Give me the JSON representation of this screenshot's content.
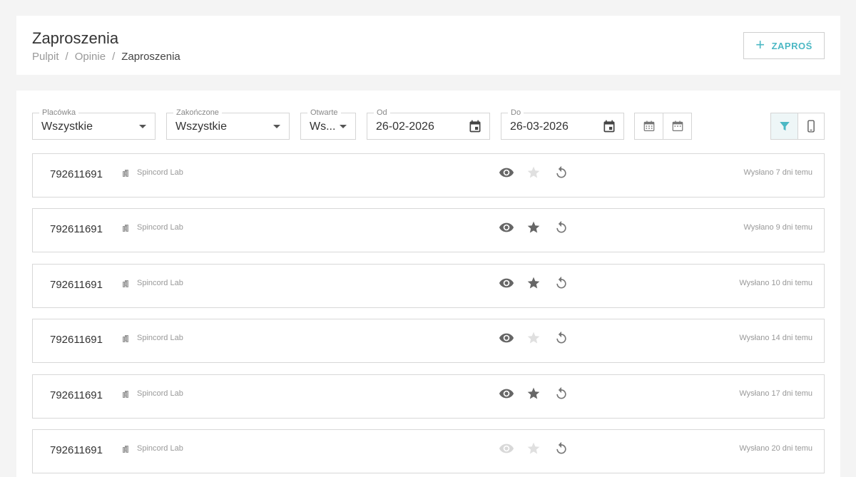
{
  "header": {
    "title": "Zaproszenia",
    "breadcrumb": [
      "Pulpit",
      "Opinie",
      "Zaproszenia"
    ],
    "breadcrumb_separator": "/",
    "invite_button": "ZAPROŚ",
    "accent_color": "#4cb8c4"
  },
  "filters": {
    "placowka": {
      "label": "Placówka",
      "value": "Wszystkie"
    },
    "zakonczone": {
      "label": "Zakończone",
      "value": "Wszystkie"
    },
    "otwarte": {
      "label": "Otwarte",
      "value": "Ws..."
    },
    "od": {
      "label": "Od",
      "value": "26-02-2026"
    },
    "do": {
      "label": "Do",
      "value": "26-03-2026"
    }
  },
  "toolbar_icons": [
    "calendar-range-icon",
    "calendar-icon",
    "filter-icon",
    "mobile-icon"
  ],
  "invitations": [
    {
      "phone": "792611691",
      "location": "Spincord Lab",
      "opened": true,
      "starred": false,
      "sent": "Wysłano 7 dni temu"
    },
    {
      "phone": "792611691",
      "location": "Spincord Lab",
      "opened": true,
      "starred": true,
      "sent": "Wysłano 9 dni temu"
    },
    {
      "phone": "792611691",
      "location": "Spincord Lab",
      "opened": true,
      "starred": true,
      "sent": "Wysłano 10 dni temu"
    },
    {
      "phone": "792611691",
      "location": "Spincord Lab",
      "opened": true,
      "starred": false,
      "sent": "Wysłano 14 dni temu"
    },
    {
      "phone": "792611691",
      "location": "Spincord Lab",
      "opened": true,
      "starred": true,
      "sent": "Wysłano 17 dni temu"
    },
    {
      "phone": "792611691",
      "location": "Spincord Lab",
      "opened": false,
      "starred": false,
      "sent": "Wysłano 20 dni temu"
    }
  ]
}
